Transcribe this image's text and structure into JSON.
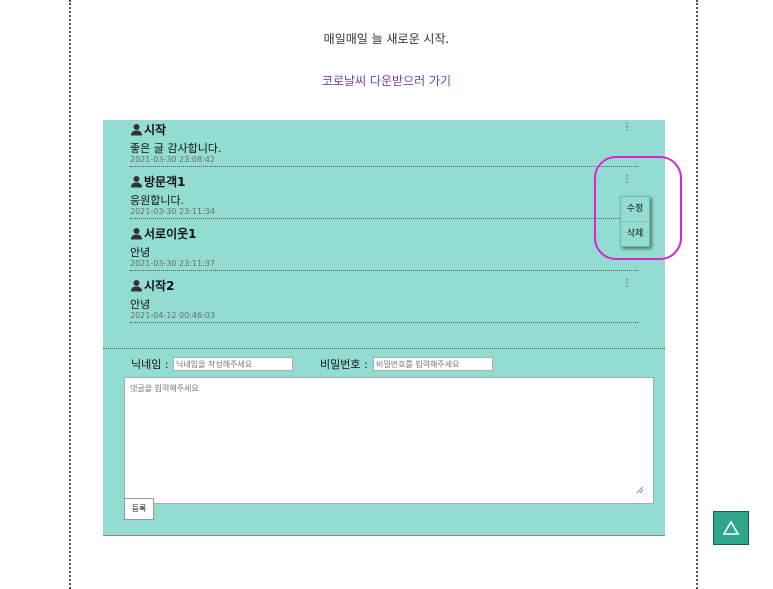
{
  "header": {
    "tagline": "매일매일 늘 새로운 시작.",
    "download_link": "코로날씨 다운받으러 가기"
  },
  "comments": [
    {
      "author": "시작",
      "body": "좋은 글 감사합니다.",
      "date": "2021-03-30 23:08:42",
      "more": "⋮"
    },
    {
      "author": "방문객1",
      "body": "응원합니다.",
      "date": "2021-03-30 23:11:34",
      "more": "⋮"
    },
    {
      "author": "서로이웃1",
      "body": "안녕",
      "date": "2021-03-30 23:11:37",
      "more": ""
    },
    {
      "author": "시작2",
      "body": "안녕",
      "date": "2021-04-12 00:46:03",
      "more": "⋮"
    }
  ],
  "context_menu": {
    "edit_label": "수정",
    "delete_label": "삭제"
  },
  "form": {
    "nickname_label": "닉네임 :",
    "nickname_placeholder": "닉네임을 작성해주세요",
    "password_label": "비밀번호 :",
    "password_placeholder": "비밀번호를 입력해주세요",
    "comment_placeholder": "댓글을 입력해주세요",
    "submit_label": "등록"
  },
  "colors": {
    "panel_bg": "#93dcd1",
    "scroll_top_button": "#2fa58e",
    "highlight_ring": "#e020d8",
    "link": "#7a3ea3"
  },
  "icons": {
    "author": "user-icon",
    "more": "more-vertical-icon",
    "scroll_top": "triangle-up-icon"
  }
}
